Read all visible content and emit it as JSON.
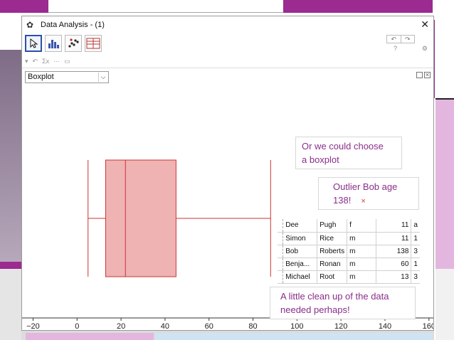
{
  "window": {
    "title": "Data Analysis - (1)",
    "close_glyph": "✕"
  },
  "toolbar": {
    "tools": [
      "move-tool",
      "histogram-tool",
      "scatter-tool",
      "table-tool"
    ],
    "undo": "↶",
    "redo": "↷",
    "help": "?",
    "settings": "⚙",
    "sub_items": [
      "▾",
      "↶",
      "Σx",
      "⋯",
      "▭"
    ]
  },
  "select": {
    "value": "Boxplot",
    "arrow": "⌵"
  },
  "callouts": {
    "boxplot_line1": "Or we could choose",
    "boxplot_line2": "a boxplot",
    "outlier_line1": "Outlier Bob age",
    "outlier_line2": "138!",
    "outlier_mark": "×",
    "cleanup_line1": "A little clean up of the data",
    "cleanup_line2": "needed perhaps!"
  },
  "table": {
    "rows": [
      {
        "first": "Dee",
        "last": "Pugh",
        "sex": "f",
        "age": "11",
        "extra": "a"
      },
      {
        "first": "Simon",
        "last": "Rice",
        "sex": "m",
        "age": "11",
        "extra": "1"
      },
      {
        "first": "Bob",
        "last": "Roberts",
        "sex": "m",
        "age": "138",
        "extra": "3"
      },
      {
        "first": "Benja...",
        "last": "Ronan",
        "sex": "m",
        "age": "60",
        "extra": "1"
      },
      {
        "first": "Michael",
        "last": "Root",
        "sex": "m",
        "age": "13",
        "extra": "3"
      }
    ]
  },
  "chart_data": {
    "type": "boxplot",
    "xlim": [
      -25,
      162
    ],
    "x_ticks": [
      -20,
      0,
      20,
      40,
      60,
      80,
      100,
      120,
      140,
      160
    ],
    "box": {
      "whisker_low": 5,
      "q1": 13,
      "median": 22,
      "q3": 45,
      "whisker_high": 88
    },
    "colors": {
      "box_fill": "#efb3b3",
      "box_stroke": "#c93434",
      "axis": "#333333"
    }
  }
}
